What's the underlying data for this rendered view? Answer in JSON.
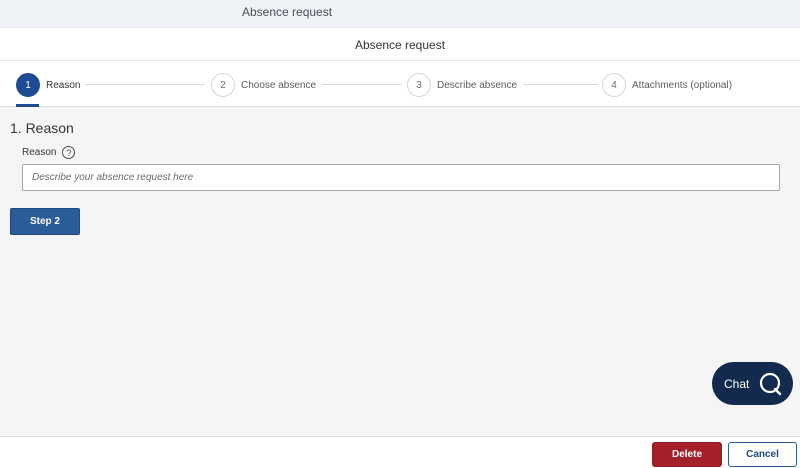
{
  "shell": {
    "title": "Absence request"
  },
  "page": {
    "title": "Absence request"
  },
  "wizard": {
    "steps": [
      {
        "number": "1",
        "label": "Reason",
        "active": true
      },
      {
        "number": "2",
        "label": "Choose absence",
        "active": false
      },
      {
        "number": "3",
        "label": "Describe absence",
        "active": false
      },
      {
        "number": "4",
        "label": "Attachments (optional)",
        "active": false
      }
    ]
  },
  "section": {
    "title": "1. Reason",
    "field_label": "Reason",
    "help_glyph": "?",
    "input_value": "",
    "input_placeholder": "Describe your absence request here",
    "next_button": "Step 2"
  },
  "chat": {
    "label": "Chat"
  },
  "footer": {
    "delete_label": "Delete",
    "cancel_label": "Cancel"
  },
  "colors": {
    "accent": "#1e4c94",
    "button": "#2b5c9a",
    "danger": "#a4202a",
    "chat": "#122a4d"
  }
}
